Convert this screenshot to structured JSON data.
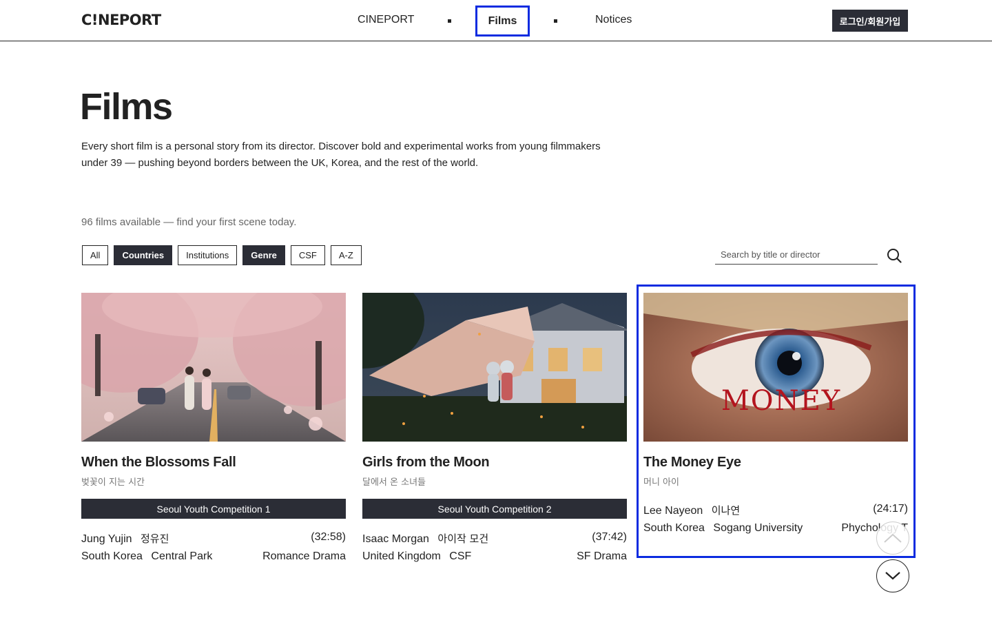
{
  "header": {
    "logo": "C!NEPORT",
    "nav": {
      "cineport": "CINEPORT",
      "films": "Films",
      "notices": "Notices"
    },
    "login_label": "로그인/회원가입"
  },
  "hero": {
    "title": "Films",
    "description": "Every short film is a personal story from its director. Discover bold and experimental works from young filmmakers under 39 — pushing beyond borders between the UK, Korea, and the rest of the world."
  },
  "films_count": "96 films available — find your first scene today.",
  "filters": [
    {
      "label": "All",
      "active": false
    },
    {
      "label": "Countries",
      "active": true
    },
    {
      "label": "Institutions",
      "active": false
    },
    {
      "label": "Genre",
      "active": true
    },
    {
      "label": "CSF",
      "active": false
    },
    {
      "label": "A-Z",
      "active": false
    }
  ],
  "search": {
    "placeholder": "Search by title or director",
    "value": ""
  },
  "films": [
    {
      "title": "When the Blossoms Fall",
      "title_kr": "벚꽃이 지는 시간",
      "competition": "Seoul Youth Competition 1",
      "director": "Jung Yujin",
      "director_kr": "정유진",
      "duration": "(32:58)",
      "country": "South Korea",
      "institution": "Central Park",
      "genre": "Romance Drama"
    },
    {
      "title": "Girls from the Moon",
      "title_kr": "달에서 온 소녀들",
      "competition": "Seoul Youth Competition 2",
      "director": "Isaac Morgan",
      "director_kr": "아이작 모건",
      "duration": "(37:42)",
      "country": "United Kingdom",
      "institution": "CSF",
      "genre": "SF Drama"
    },
    {
      "title": "The Money Eye",
      "title_kr": "머니 아이",
      "director": "Lee Nayeon",
      "director_kr": "이나연",
      "duration": "(24:17)",
      "country": "South Korea",
      "institution": "Sogang University",
      "genre": "Phychology T",
      "poster_text": "MONEY"
    }
  ],
  "colors": {
    "dark": "#2b2d36",
    "highlight": "#0b2be0"
  }
}
